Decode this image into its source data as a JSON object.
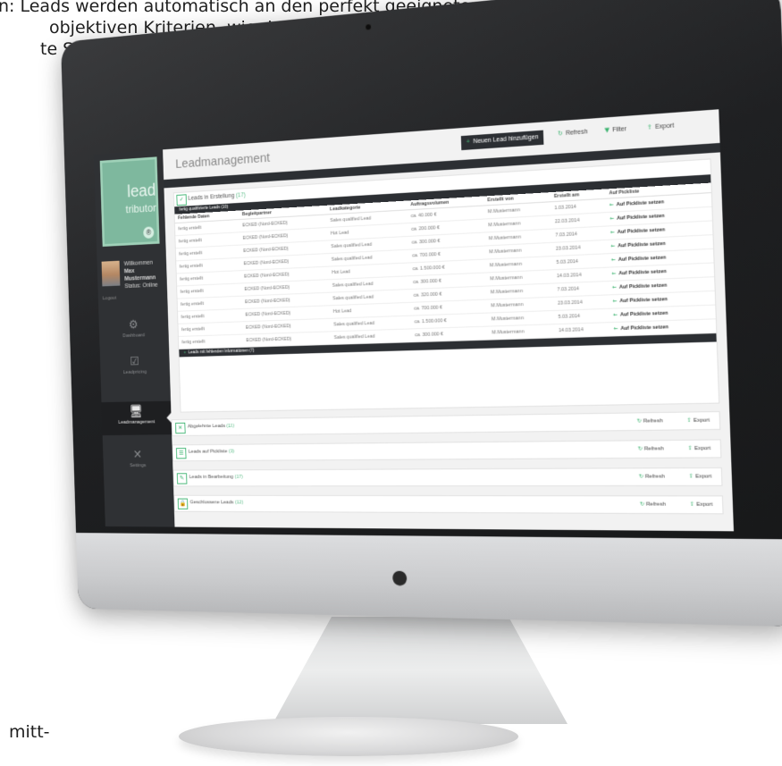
{
  "page_text": {
    "line1": "n: Leads werden automatisch an den perfekt geeigneten",
    "line2": "objektiven Kriterien, wie der regionalen",
    "line3": "te System bietet allen",
    "bottom": "mitt-"
  },
  "logo": {
    "line1": "lead",
    "line2": "tributor",
    "mark": "®"
  },
  "user": {
    "greeting": "Willkommen",
    "name": "Max Mustermann",
    "status": "Status: Online",
    "logout": "Logout"
  },
  "nav": [
    {
      "icon": "dashboard-icon",
      "label": "Dashboard",
      "glyph": "⚙"
    },
    {
      "icon": "leadpricing-icon",
      "label": "Leadpricing",
      "glyph": "☑"
    },
    {
      "icon": "leadmanagement-icon",
      "label": "Leadmanagement",
      "glyph": "🖥"
    },
    {
      "icon": "settings-icon",
      "label": "Settings",
      "glyph": "✕"
    }
  ],
  "header": {
    "title": "Leadmanagement",
    "new_lead": "Neuen Lead hinzufügen",
    "refresh": "Refresh",
    "filter": "Filter",
    "export": "Export"
  },
  "panel": {
    "title": "Leads in Erstellung",
    "count": "(17)",
    "subhead": "fertig qualifizierte Leads (10)",
    "columns": [
      "Fehlende Daten",
      "Begleitpartner",
      "Leadkategorie",
      "Auftragsvolumen",
      "Erstellt von",
      "Erstellt am",
      "Auf Pickliste"
    ],
    "rows": [
      [
        "fertig erstellt",
        "ECKED (Nord-ECKED)",
        "Sales qualified Lead",
        "ca. 40.000 €",
        "M.Mustermann",
        "1.03.2014",
        "Auf Pickliste setzen"
      ],
      [
        "fertig erstellt",
        "ECKED (Nord-ECKED)",
        "Hot Lead",
        "ca. 200.000 €",
        "M.Mustermann",
        "22.03.2014",
        "Auf Pickliste setzen"
      ],
      [
        "fertig erstellt",
        "ECKED (Nord-ECKED)",
        "Sales qualified Lead",
        "ca. 300.000 €",
        "M.Mustermann",
        "7.03.2014",
        "Auf Pickliste setzen"
      ],
      [
        "fertig erstellt",
        "ECKED (Nord-ECKED)",
        "Sales qualified Lead",
        "ca. 700.000 €",
        "M.Mustermann",
        "23.03.2014",
        "Auf Pickliste setzen"
      ],
      [
        "fertig erstellt",
        "ECKED (Nord-ECKED)",
        "Hot Lead",
        "ca. 1.500.000 €",
        "M.Mustermann",
        "5.03.2014",
        "Auf Pickliste setzen"
      ],
      [
        "fertig erstellt",
        "ECKED (Nord-ECKED)",
        "Sales qualified Lead",
        "ca. 300.000 €",
        "M.Mustermann",
        "14.03.2014",
        "Auf Pickliste setzen"
      ],
      [
        "fertig erstellt",
        "ECKED (Nord-ECKED)",
        "Sales qualified Lead",
        "ca. 320.000 €",
        "M.Mustermann",
        "7.03.2014",
        "Auf Pickliste setzen"
      ],
      [
        "fertig erstellt",
        "ECKED (Nord-ECKED)",
        "Hot Lead",
        "ca. 700.000 €",
        "M.Mustermann",
        "23.03.2014",
        "Auf Pickliste setzen"
      ],
      [
        "fertig erstellt",
        "ECKED (Nord-ECKED)",
        "Sales qualified Lead",
        "ca. 1.500.000 €",
        "M.Mustermann",
        "5.03.2014",
        "Auf Pickliste setzen"
      ],
      [
        "fertig erstellt",
        "ECKED (Nord-ECKED)",
        "Sales qualified Lead",
        "ca. 300.000 €",
        "M.Mustermann",
        "14.03.2014",
        "Auf Pickliste setzen"
      ]
    ],
    "subfoot": "Leads mit fehlenden Informationen (7)"
  },
  "collapsed": [
    {
      "label": "Abgelehnte Leads",
      "count": "(11)",
      "icon": "close-icon",
      "glyph": "✕"
    },
    {
      "label": "Leads auf Pickliste",
      "count": "(3)",
      "icon": "list-icon",
      "glyph": "☰"
    },
    {
      "label": "Leads in Bearbeitung",
      "count": "(17)",
      "icon": "edit-icon",
      "glyph": "✎"
    },
    {
      "label": "Geschlossene Leads",
      "count": "(12)",
      "icon": "lock-icon",
      "glyph": "🔒"
    }
  ],
  "collapsed_actions": {
    "refresh": "Refresh",
    "export": "Export"
  },
  "colors": {
    "accent": "#3bb36f",
    "sidebar": "#2f3134",
    "logo": "#7eb89e"
  }
}
